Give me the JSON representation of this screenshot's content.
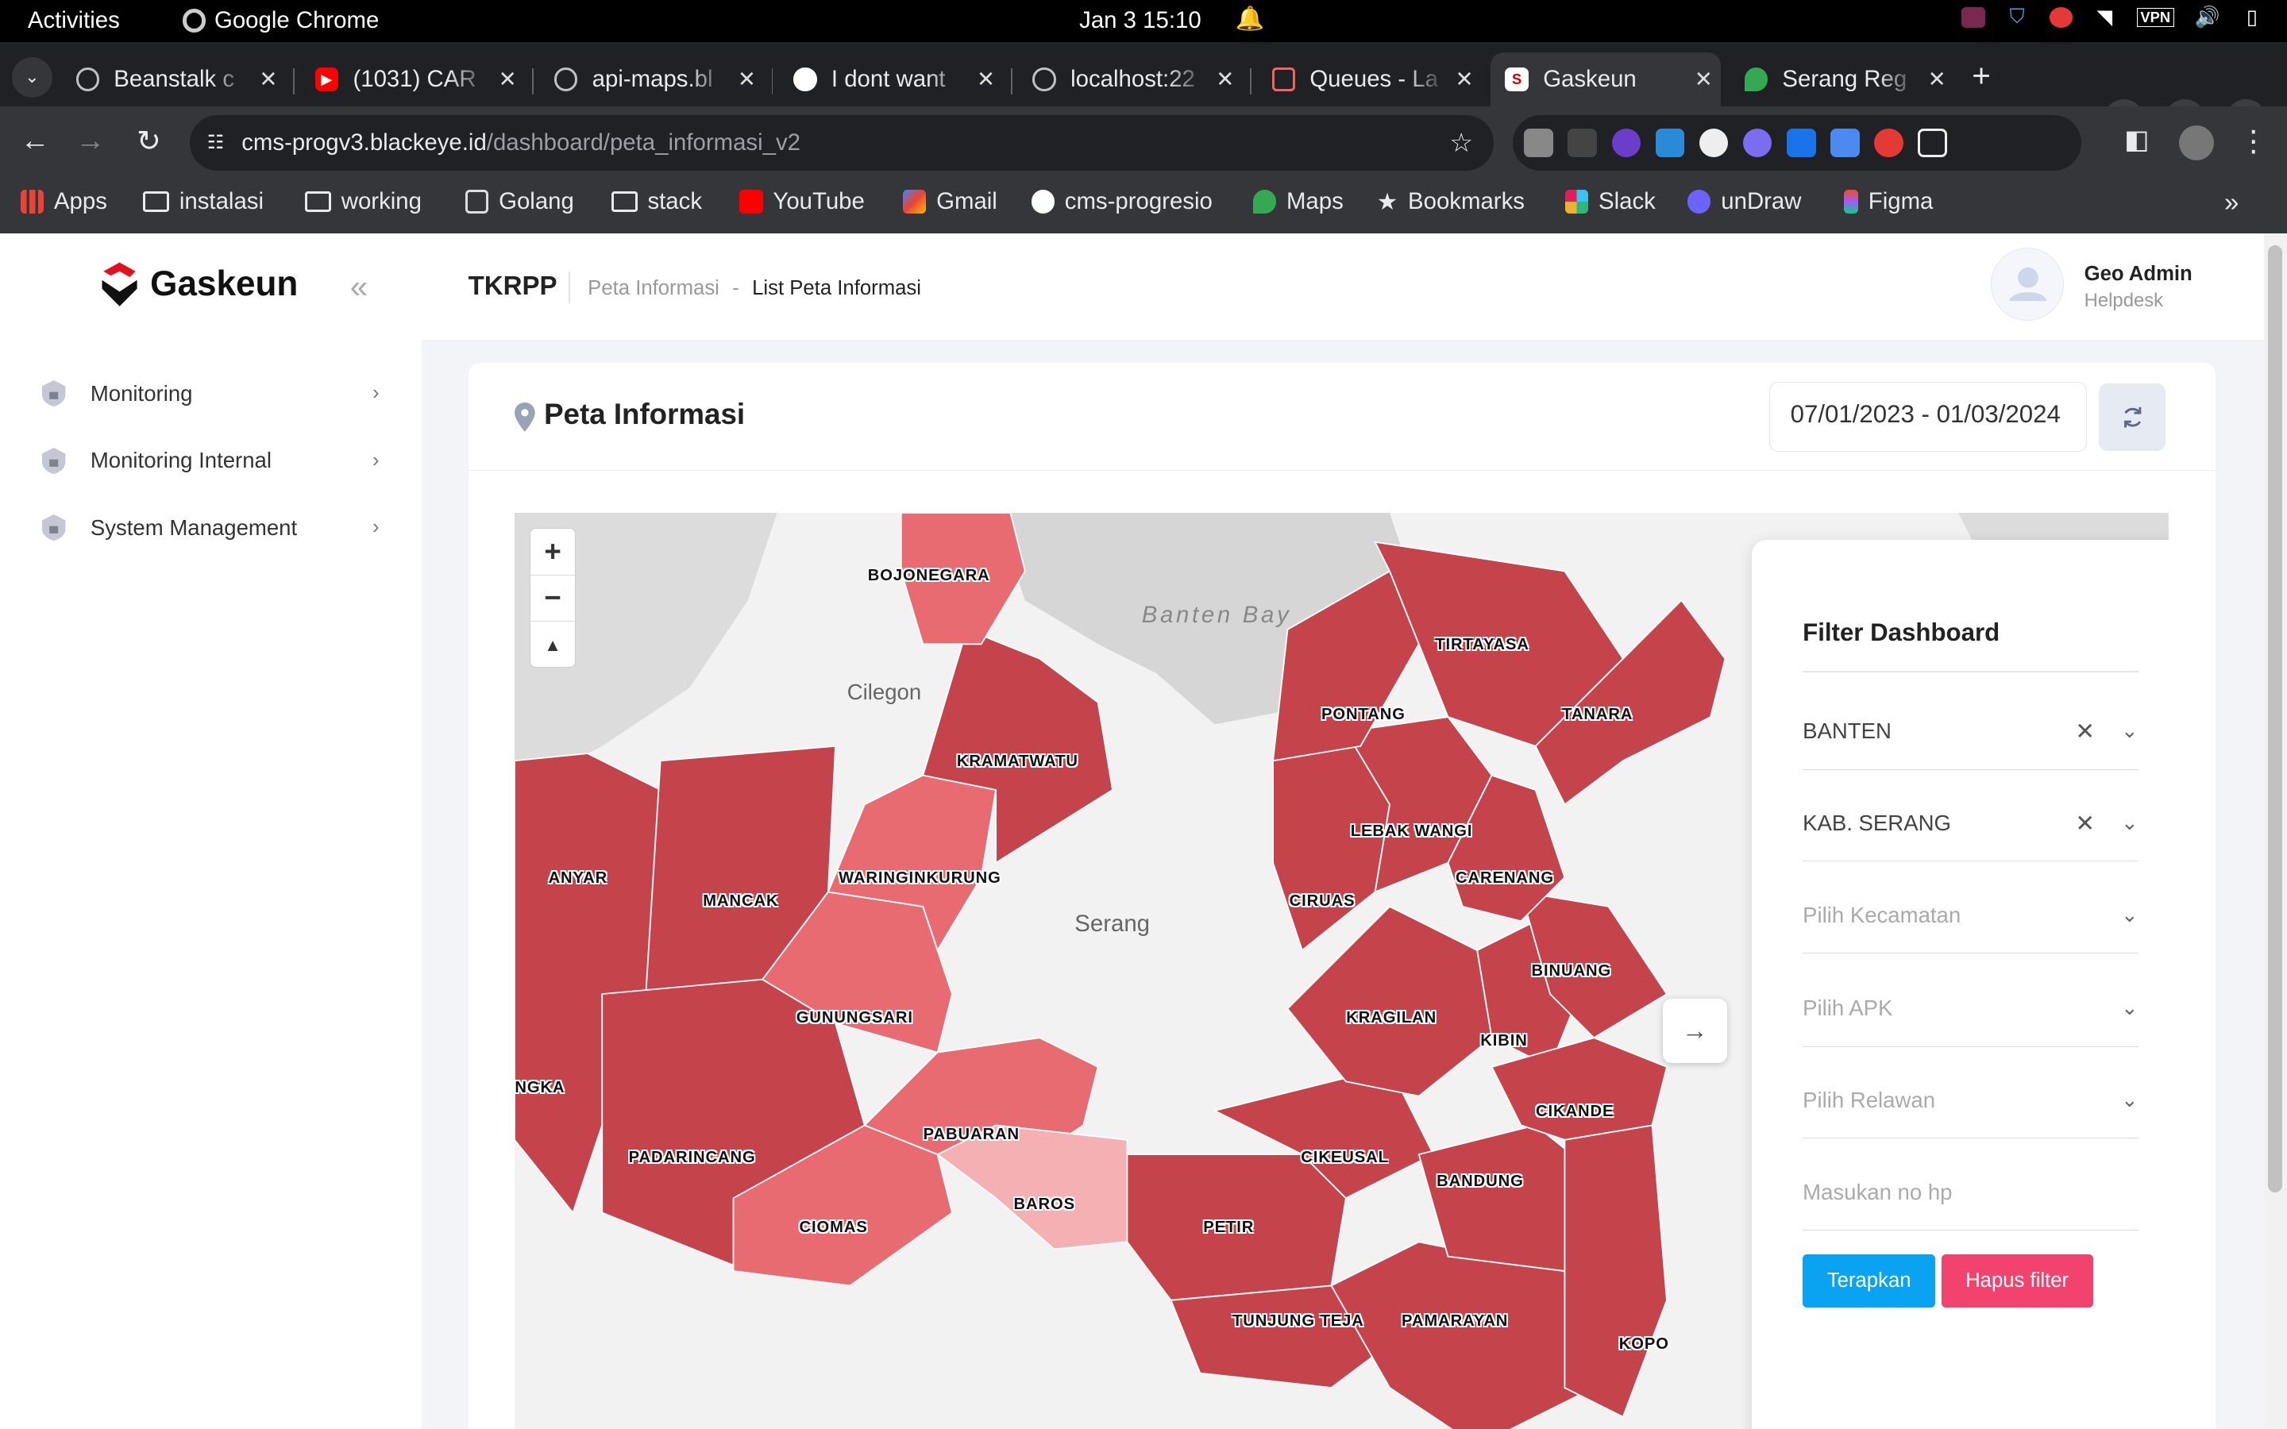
{
  "os": {
    "activities": "Activities",
    "app": "Google Chrome",
    "clock": "Jan 3  15:10",
    "tray_vpn": "VPN"
  },
  "tabs": [
    {
      "title": "Beanstalk c",
      "icon": "globe-icon",
      "color": "#bdc1c6"
    },
    {
      "title": "(1031) CAR",
      "icon": "youtube-icon",
      "color": "#ff0000"
    },
    {
      "title": "api-maps.bl",
      "icon": "globe-icon",
      "color": "#bdc1c6"
    },
    {
      "title": "I dont want",
      "icon": "github-icon",
      "color": "#ffffff"
    },
    {
      "title": "localhost:22",
      "icon": "globe-icon",
      "color": "#bdc1c6"
    },
    {
      "title": "Queues - La",
      "icon": "laravel-icon",
      "color": "#f4645f"
    },
    {
      "title": "Gaskeun",
      "icon": "gaskeun-icon",
      "color": "#ffffff"
    },
    {
      "title": "Serang Reg",
      "icon": "maps-icon",
      "color": "#34a853"
    }
  ],
  "url": {
    "host": "cms-progv3.blackeye.id",
    "path": "/dashboard/peta_informasi_v2"
  },
  "bookmarks": [
    {
      "label": "Apps",
      "icon": "apps-icon"
    },
    {
      "label": "instalasi",
      "icon": "folder-icon"
    },
    {
      "label": "working",
      "icon": "folder-icon"
    },
    {
      "label": "Golang",
      "icon": "book-icon"
    },
    {
      "label": "stack",
      "icon": "folder-icon"
    },
    {
      "label": "YouTube",
      "icon": "youtube-icon"
    },
    {
      "label": "Gmail",
      "icon": "gmail-icon"
    },
    {
      "label": "cms-progresio",
      "icon": "gaskeun-icon"
    },
    {
      "label": "Maps",
      "icon": "maps-icon"
    },
    {
      "label": "Bookmarks",
      "icon": "star-icon"
    },
    {
      "label": "Slack",
      "icon": "slack-icon"
    },
    {
      "label": "unDraw",
      "icon": "undraw-icon"
    },
    {
      "label": "Figma",
      "icon": "figma-icon"
    }
  ],
  "sidebar": {
    "logo": "Gaskeun",
    "items": [
      {
        "label": "Monitoring"
      },
      {
        "label": "Monitoring Internal"
      },
      {
        "label": "System Management"
      }
    ]
  },
  "header": {
    "brand": "TKRPP",
    "crumb1": "Peta Informasi",
    "crumb_sep": "-",
    "crumb2": "List Peta Informasi",
    "user_name": "Geo Admin",
    "user_role": "Helpdesk"
  },
  "page": {
    "title": "Peta Informasi",
    "date_range": "07/01/2023 - 01/03/2024"
  },
  "map": {
    "bay": "Banten Bay",
    "cities": [
      {
        "name": "Cilegon"
      },
      {
        "name": "Serang"
      }
    ],
    "regions": [
      {
        "name": "BOJONEGARA",
        "level": 2
      },
      {
        "name": "TIRTAYASA",
        "level": 3
      },
      {
        "name": "PONTANG",
        "level": 3
      },
      {
        "name": "TANARA",
        "level": 3
      },
      {
        "name": "KRAMATWATU",
        "level": 3
      },
      {
        "name": "LEBAK WANGI",
        "level": 3
      },
      {
        "name": "ANYAR",
        "level": 3
      },
      {
        "name": "MANCAK",
        "level": 3
      },
      {
        "name": "WARINGINKURUNG",
        "level": 2
      },
      {
        "name": "CIRUAS",
        "level": 3
      },
      {
        "name": "CARENANG",
        "level": 3
      },
      {
        "name": "BINUANG",
        "level": 3
      },
      {
        "name": "GUNUNGSARI",
        "level": 2
      },
      {
        "name": "KRAGILAN",
        "level": 3
      },
      {
        "name": "KIBIN",
        "level": 3
      },
      {
        "name": "NGKA",
        "level": 3
      },
      {
        "name": "CIKANDE",
        "level": 3
      },
      {
        "name": "PABUARAN",
        "level": 2
      },
      {
        "name": "PADARINCANG",
        "level": 3
      },
      {
        "name": "CIKEUSAL",
        "level": 3
      },
      {
        "name": "BAROS",
        "level": 1
      },
      {
        "name": "BANDUNG",
        "level": 3
      },
      {
        "name": "CIOMAS",
        "level": 2
      },
      {
        "name": "PETIR",
        "level": 3
      },
      {
        "name": "TUNJUNG TEJA",
        "level": 3
      },
      {
        "name": "PAMARAYAN",
        "level": 3
      },
      {
        "name": "KOPO",
        "level": 3
      }
    ],
    "colors": {
      "level1": "#f5b0b4",
      "level2": "#e96b72",
      "level3": "#c5444c",
      "bg": "#e9e9e9"
    }
  },
  "filter": {
    "title": "Filter Dashboard",
    "province": "BANTEN",
    "regency": "KAB. SERANG",
    "district_ph": "Pilih Kecamatan",
    "apk_ph": "Pilih APK",
    "volunteer_ph": "Pilih Relawan",
    "phone_ph": "Masukan no hp",
    "apply": "Terapkan",
    "clear": "Hapus filter"
  }
}
